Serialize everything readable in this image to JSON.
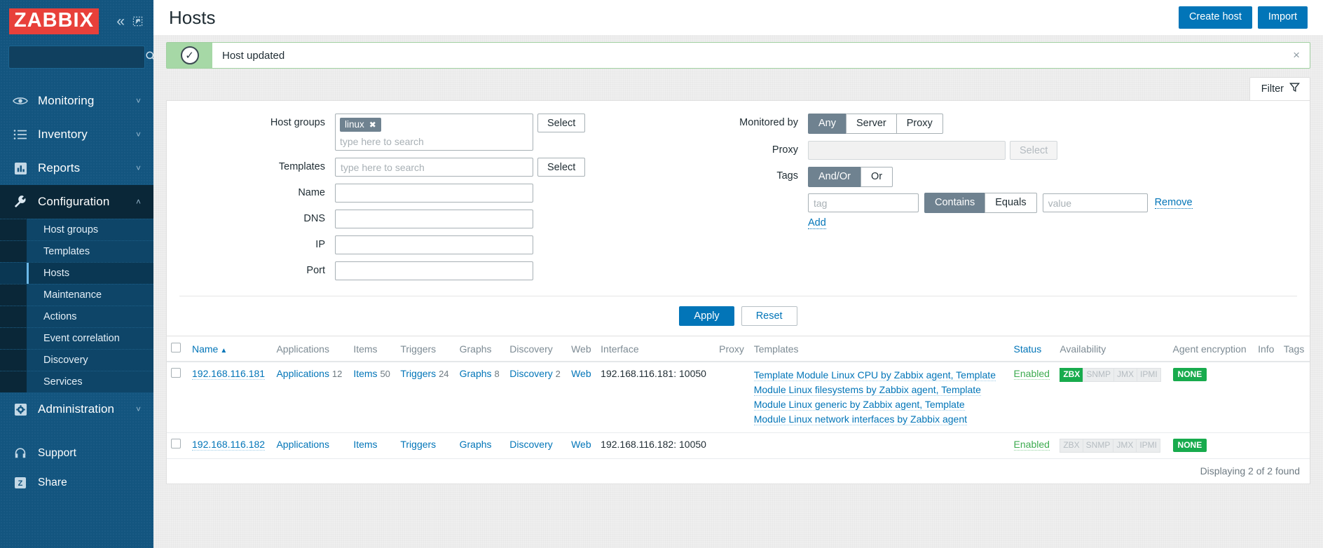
{
  "sidebar": {
    "logo": "ZABBIX",
    "collapse_icon": "double-chevron-left-icon",
    "expand_icon": "expand-icon",
    "search_placeholder": "",
    "search_icon": "search-icon",
    "nav": [
      {
        "label": "Monitoring",
        "icon": "eye-icon",
        "caret": "˅"
      },
      {
        "label": "Inventory",
        "icon": "list-icon",
        "caret": "˅"
      },
      {
        "label": "Reports",
        "icon": "chart-bar-icon",
        "caret": "˅"
      },
      {
        "label": "Configuration",
        "icon": "wrench-icon",
        "caret": "˄"
      }
    ],
    "submenu": [
      {
        "label": "Host groups"
      },
      {
        "label": "Templates"
      },
      {
        "label": "Hosts"
      },
      {
        "label": "Maintenance"
      },
      {
        "label": "Actions"
      },
      {
        "label": "Event correlation"
      },
      {
        "label": "Discovery"
      },
      {
        "label": "Services"
      }
    ],
    "nav_bottom": [
      {
        "label": "Administration",
        "icon": "gear-icon",
        "caret": "˅"
      }
    ],
    "nav_footer": [
      {
        "label": "Support",
        "icon": "headset-icon"
      },
      {
        "label": "Share",
        "icon": "zabbix-z-icon"
      }
    ]
  },
  "header": {
    "title": "Hosts",
    "create_host_label": "Create host",
    "import_label": "Import"
  },
  "message": {
    "text": "Host updated",
    "icon": "check-circle-icon",
    "close_icon": "×"
  },
  "filter_tab": {
    "label": "Filter",
    "icon": "funnel-icon"
  },
  "filter": {
    "host_groups": {
      "label": "Host groups",
      "chips": [
        {
          "text": "linux",
          "remove_icon": "✖"
        }
      ],
      "placeholder": "type here to search",
      "select_label": "Select"
    },
    "templates": {
      "label": "Templates",
      "value": "",
      "placeholder": "type here to search",
      "select_label": "Select"
    },
    "name": {
      "label": "Name",
      "value": "",
      "placeholder": ""
    },
    "dns": {
      "label": "DNS",
      "value": "",
      "placeholder": ""
    },
    "ip": {
      "label": "IP",
      "value": "",
      "placeholder": ""
    },
    "port": {
      "label": "Port",
      "value": "",
      "placeholder": ""
    },
    "monitored_by": {
      "label": "Monitored by",
      "options": [
        "Any",
        "Server",
        "Proxy"
      ],
      "selected": "Any"
    },
    "proxy": {
      "label": "Proxy",
      "value": "",
      "placeholder": "",
      "select_label": "Select"
    },
    "tags": {
      "label": "Tags",
      "operator_options": [
        "And/Or",
        "Or"
      ],
      "operator_selected": "And/Or",
      "tag_placeholder": "tag",
      "tag_value": "",
      "match_options": [
        "Contains",
        "Equals"
      ],
      "match_selected": "Contains",
      "value_placeholder": "value",
      "value_value": "",
      "remove_label": "Remove",
      "add_label": "Add"
    },
    "apply_label": "Apply",
    "reset_label": "Reset"
  },
  "table": {
    "columns": [
      "Name",
      "Applications",
      "Items",
      "Triggers",
      "Graphs",
      "Discovery",
      "Web",
      "Interface",
      "Proxy",
      "Templates",
      "Status",
      "Availability",
      "Agent encryption",
      "Info",
      "Tags"
    ],
    "sort_column": "Name",
    "sort_dir": "▲",
    "rows": [
      {
        "name": "192.168.116.181",
        "applications": {
          "label": "Applications",
          "count": "12"
        },
        "items": {
          "label": "Items",
          "count": "50"
        },
        "triggers": {
          "label": "Triggers",
          "count": "24"
        },
        "graphs": {
          "label": "Graphs",
          "count": "8"
        },
        "discovery": {
          "label": "Discovery",
          "count": "2"
        },
        "web": {
          "label": "Web",
          "count": ""
        },
        "interface": "192.168.116.181: 10050",
        "proxy": "",
        "templates": [
          "Template Module Linux CPU by Zabbix agent, Template",
          "Module Linux filesystems by Zabbix agent, Template",
          "Module Linux generic by Zabbix agent, Template",
          "Module Linux network interfaces by Zabbix agent"
        ],
        "status": "Enabled",
        "availability": [
          {
            "label": "ZBX",
            "active": true
          },
          {
            "label": "SNMP",
            "active": false
          },
          {
            "label": "JMX",
            "active": false
          },
          {
            "label": "IPMI",
            "active": false
          }
        ],
        "agent_encryption": "NONE",
        "info": "",
        "tags": ""
      },
      {
        "name": "192.168.116.182",
        "applications": {
          "label": "Applications",
          "count": ""
        },
        "items": {
          "label": "Items",
          "count": ""
        },
        "triggers": {
          "label": "Triggers",
          "count": ""
        },
        "graphs": {
          "label": "Graphs",
          "count": ""
        },
        "discovery": {
          "label": "Discovery",
          "count": ""
        },
        "web": {
          "label": "Web",
          "count": ""
        },
        "interface": "192.168.116.182: 10050",
        "proxy": "",
        "templates": [],
        "status": "Enabled",
        "availability": [
          {
            "label": "ZBX",
            "active": false
          },
          {
            "label": "SNMP",
            "active": false
          },
          {
            "label": "JMX",
            "active": false
          },
          {
            "label": "IPMI",
            "active": false
          }
        ],
        "agent_encryption": "NONE",
        "info": "",
        "tags": ""
      }
    ],
    "footer_text": "Displaying 2 of 2 found"
  },
  "colors": {
    "brand_red": "#e8403a",
    "sidebar_blue": "#13557f",
    "accent_blue": "#0275b8",
    "success_green": "#18ab4d",
    "msg_green": "#a6d8a6",
    "segment_grey": "#6f8290"
  }
}
